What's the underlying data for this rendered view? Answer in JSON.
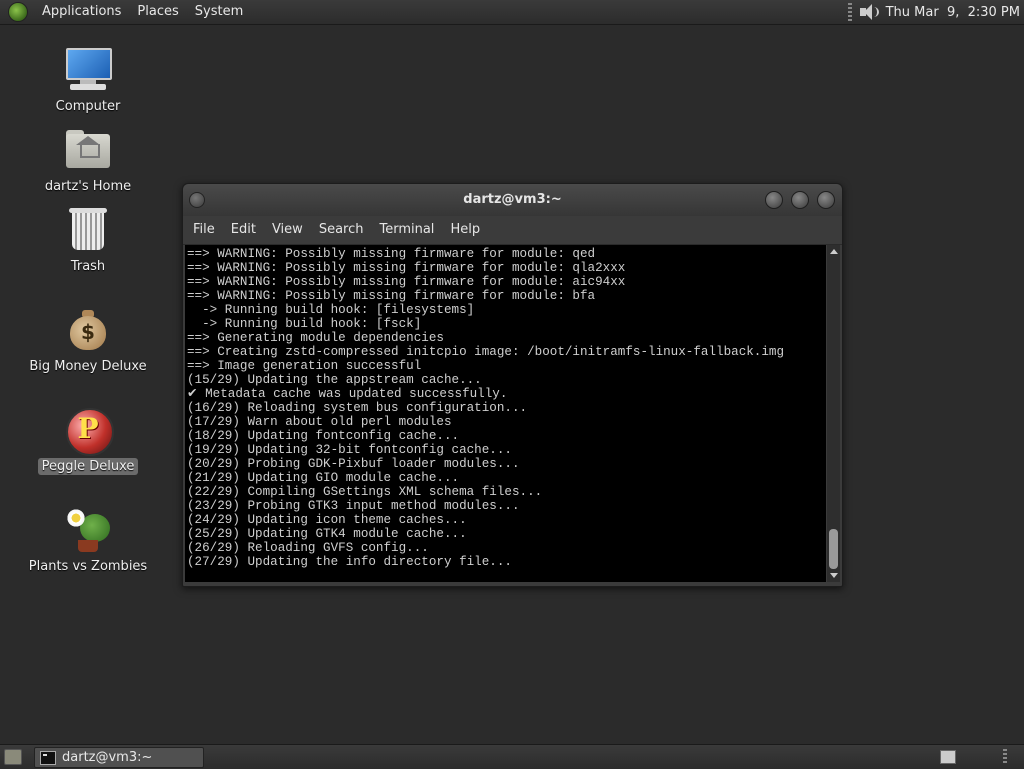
{
  "top_panel": {
    "menus": [
      "Applications",
      "Places",
      "System"
    ],
    "clock": "Thu Mar  9,  2:30 PM"
  },
  "desktop_icons": [
    {
      "label": "Computer",
      "icon": "computer-icon"
    },
    {
      "label": "dartz's Home",
      "icon": "home-folder-icon"
    },
    {
      "label": "Trash",
      "icon": "trash-icon"
    },
    {
      "label": "Big Money Deluxe",
      "icon": "money-bag-icon"
    },
    {
      "label": "Peggle Deluxe",
      "icon": "peggle-icon",
      "selected": true
    },
    {
      "label": "Plants vs Zombies",
      "icon": "plants-vs-zombies-icon"
    }
  ],
  "terminal_window": {
    "title": "dartz@vm3:~",
    "menu": [
      "File",
      "Edit",
      "View",
      "Search",
      "Terminal",
      "Help"
    ],
    "output": "==> WARNING: Possibly missing firmware for module: qed\n==> WARNING: Possibly missing firmware for module: qla2xxx\n==> WARNING: Possibly missing firmware for module: aic94xx\n==> WARNING: Possibly missing firmware for module: bfa\n  -> Running build hook: [filesystems]\n  -> Running build hook: [fsck]\n==> Generating module dependencies\n==> Creating zstd-compressed initcpio image: /boot/initramfs-linux-fallback.img\n==> Image generation successful\n(15/29) Updating the appstream cache...\n✔ Metadata cache was updated successfully.\n(16/29) Reloading system bus configuration...\n(17/29) Warn about old perl modules\n(18/29) Updating fontconfig cache...\n(19/29) Updating 32-bit fontconfig cache...\n(20/29) Probing GDK-Pixbuf loader modules...\n(21/29) Updating GIO module cache...\n(22/29) Compiling GSettings XML schema files...\n(23/29) Probing GTK3 input method modules...\n(24/29) Updating icon theme caches...\n(25/29) Updating GTK4 module cache...\n(26/29) Reloading GVFS config...\n(27/29) Updating the info directory file..."
  },
  "bottom_panel": {
    "taskbar_item": "dartz@vm3:~"
  }
}
